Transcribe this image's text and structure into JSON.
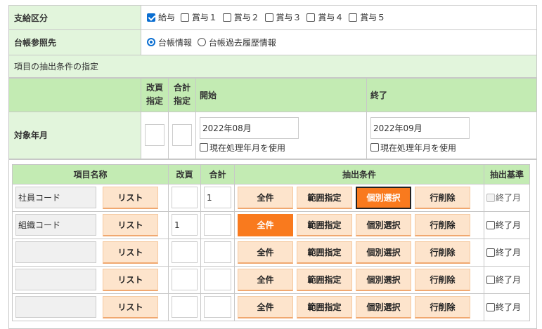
{
  "payment": {
    "label": "支給区分",
    "options": [
      {
        "label": "給与",
        "checked": true
      },
      {
        "label": "賞与１",
        "checked": false
      },
      {
        "label": "賞与２",
        "checked": false
      },
      {
        "label": "賞与３",
        "checked": false
      },
      {
        "label": "賞与４",
        "checked": false
      },
      {
        "label": "賞与５",
        "checked": false
      }
    ]
  },
  "ledger": {
    "label": "台帳参照先",
    "options": [
      {
        "label": "台帳情報",
        "selected": true
      },
      {
        "label": "台帳過去履歴情報",
        "selected": false
      }
    ]
  },
  "section_title": "項目の抽出条件の指定",
  "period_header": {
    "page_break": "改頁",
    "page_break2": "指定",
    "total": "合計",
    "total2": "指定",
    "start": "開始",
    "end": "終了"
  },
  "period": {
    "label": "対象年月",
    "start_value": "2022年08月",
    "end_value": "2022年09月",
    "use_current": "現在処理年月を使用"
  },
  "items_header": {
    "name": "項目名称",
    "page_break": "改頁",
    "total": "合計",
    "condition": "抽出条件",
    "basis": "抽出基準"
  },
  "buttons": {
    "list": "リスト",
    "all": "全件",
    "range": "範囲指定",
    "individual": "個別選択",
    "delete": "行削除",
    "end_month": "終了月"
  },
  "rows": [
    {
      "name": "社員コード",
      "page_break": "",
      "total": "1",
      "active": "individual",
      "basis_disabled": true
    },
    {
      "name": "組織コード",
      "page_break": "1",
      "total": "",
      "active": "all",
      "basis_disabled": false
    },
    {
      "name": "",
      "page_break": "",
      "total": "",
      "active": "",
      "basis_disabled": false
    },
    {
      "name": "",
      "page_break": "",
      "total": "",
      "active": "",
      "basis_disabled": false
    },
    {
      "name": "",
      "page_break": "",
      "total": "",
      "active": "",
      "basis_disabled": false
    }
  ]
}
